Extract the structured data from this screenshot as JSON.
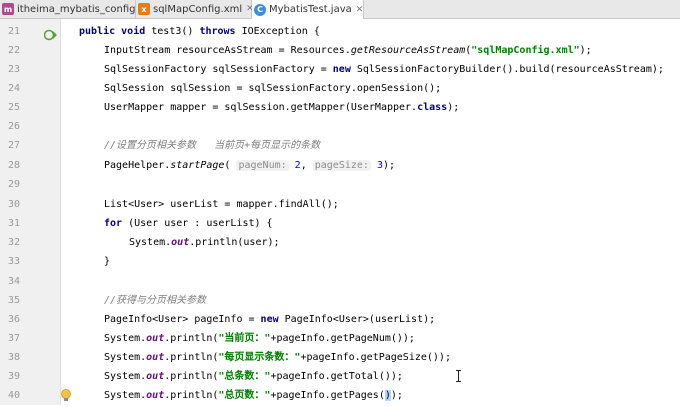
{
  "tabs": [
    {
      "label": "itheima_mybatis_config",
      "icon": "module-icon"
    },
    {
      "label": "sqlMapConfig.xml",
      "icon": "xml-file-icon"
    },
    {
      "label": "MybatisTest.java",
      "icon": "java-class-icon",
      "active": true
    }
  ],
  "line_numbers": [
    "21",
    "22",
    "23",
    "24",
    "25",
    "26",
    "27",
    "28",
    "29",
    "30",
    "31",
    "32",
    "33",
    "34",
    "35",
    "36",
    "37",
    "38",
    "39",
    "40"
  ],
  "colors": {
    "keyword": "#000080",
    "string": "#008000",
    "field": "#660e7a",
    "number": "#0000ff",
    "comment": "#808080"
  },
  "code": {
    "l21": {
      "pub": "public",
      "void": "void",
      "name": " test3() ",
      "throws": "throws",
      "rest": " IOException {"
    },
    "l22": {
      "a": "InputStream resourceAsStream = Resources.",
      "m": "getResourceAsStream",
      "b": "(",
      "s": "\"sqlMapConfig.xml\"",
      "c": ");"
    },
    "l23": {
      "a": "SqlSessionFactory sqlSessionFactory = ",
      "new": "new",
      "b": " SqlSessionFactoryBuilder().build(resourceAsStream);"
    },
    "l24": "SqlSession sqlSession = sqlSessionFactory.openSession();",
    "l25": {
      "a": "UserMapper mapper = sqlSession.getMapper(UserMapper.",
      "cls": "class",
      "b": ");"
    },
    "l27": "//设置分页相关参数   当前页+每页显示的条数",
    "l28": {
      "a": "PageHelper.",
      "m": "startPage",
      "b": "( ",
      "h1": "pageNum:",
      "n1": "2",
      "c": ", ",
      "h2": "pageSize:",
      "n2": "3",
      "d": ");"
    },
    "l30": "List<User> userList = mapper.findAll();",
    "l31": {
      "for": "for",
      "b": " (User user : userList) {"
    },
    "l32": {
      "a": "System.",
      "f": "out",
      "b": ".println(user);"
    },
    "l33": "}",
    "l35": "//获得与分页相关参数",
    "l36": {
      "a": "PageInfo<User> pageInfo = ",
      "new": "new",
      "b": " PageInfo<User>(userList);"
    },
    "l37": {
      "a": "System.",
      "f": "out",
      "b": ".println(",
      "s": "\"当前页：\"",
      "c": "+pageInfo.getPageNum());"
    },
    "l38": {
      "a": "System.",
      "f": "out",
      "b": ".println(",
      "s": "\"每页显示条数：\"",
      "c": "+pageInfo.getPageSize());"
    },
    "l39": {
      "a": "System.",
      "f": "out",
      "b": ".println(",
      "s": "\"总条数：\"",
      "c": "+pageInfo.getTotal());"
    },
    "l40": {
      "a": "System.",
      "f": "out",
      "b": ".println(",
      "s": "\"总页数：\"",
      "c": "+pageInfo.getPages(",
      "sel": ")",
      "d": ");"
    }
  },
  "gutter_icons": {
    "run": "run-test-icon",
    "bulb": "lightbulb-icon"
  }
}
